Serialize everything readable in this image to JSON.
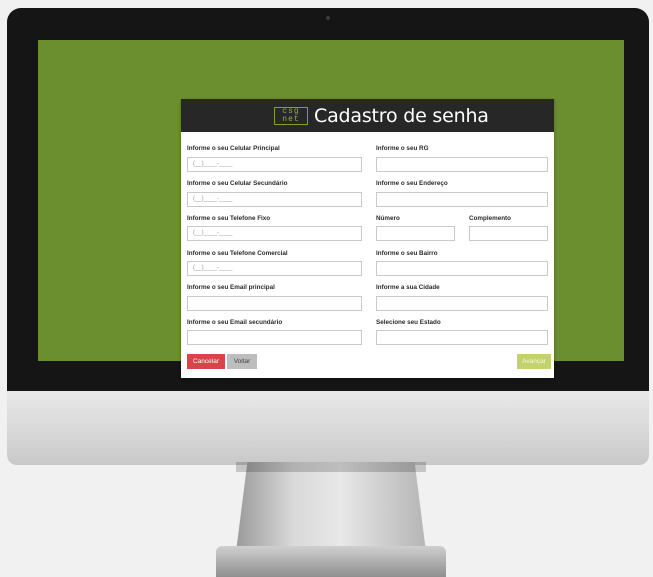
{
  "header": {
    "logo_top": "csg",
    "logo_bottom": "net",
    "title": "Cadastro de senha"
  },
  "left": [
    {
      "label": "Informe o seu Celular Principal",
      "placeholder": "(__)____-____"
    },
    {
      "label": "Informe o seu Celular Secundário",
      "placeholder": "(__)____-____"
    },
    {
      "label": "Informe o seu Telefone Fixo",
      "placeholder": "(__)____-____"
    },
    {
      "label": "Informe o seu Telefone Comercial",
      "placeholder": "(__)____-____"
    },
    {
      "label": "Informe o seu Email principal",
      "placeholder": ""
    },
    {
      "label": "Informe o seu Email secundário",
      "placeholder": ""
    }
  ],
  "right": {
    "rg": "Informe o seu RG",
    "endereco": "Informe o seu Endereço",
    "numero": "Número",
    "complemento": "Complemento",
    "bairro": "Informe o seu Bairro",
    "cidade": "Informe a sua Cidade",
    "estado": "Selecione seu Estado"
  },
  "buttons": {
    "cancel": "Cancelar",
    "back": "Voltar",
    "next": "Avançar"
  },
  "colors": {
    "screen_bg": "#6b8e2e",
    "cancel": "#d9444a",
    "next": "#c4d26d",
    "header": "#272727"
  }
}
